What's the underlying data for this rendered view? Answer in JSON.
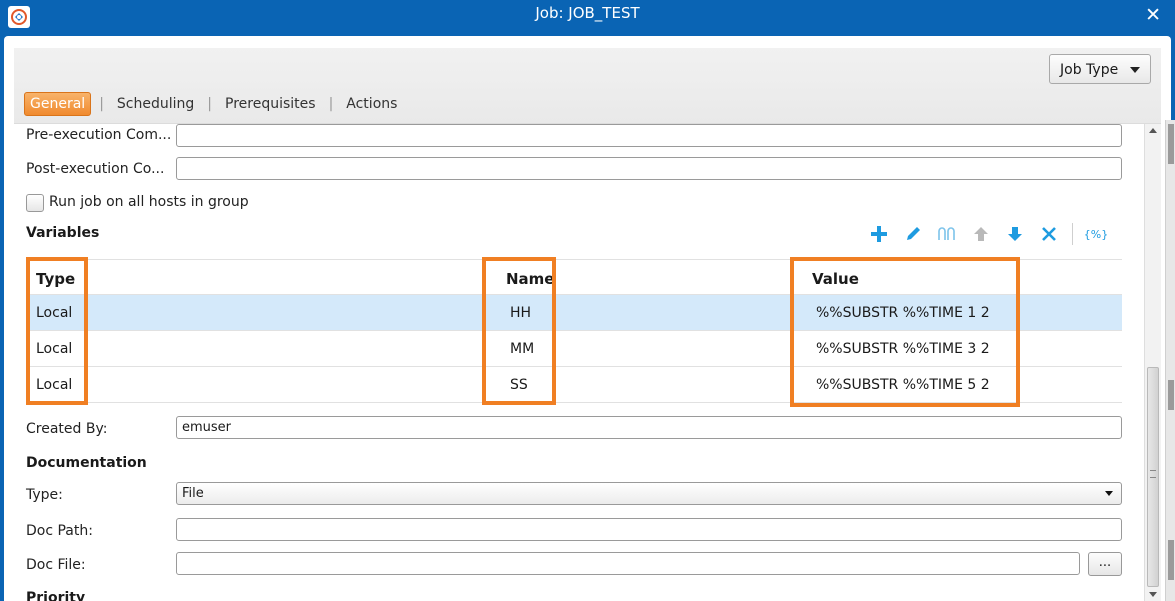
{
  "window": {
    "title": "Job: JOB_TEST",
    "close_glyph": "✕"
  },
  "header": {
    "job_type_label": "Job Type",
    "tabs": [
      {
        "label": "General",
        "active": true
      },
      {
        "label": "Scheduling",
        "active": false
      },
      {
        "label": "Prerequisites",
        "active": false
      },
      {
        "label": "Actions",
        "active": false
      }
    ]
  },
  "form": {
    "pre_exec_label": "Pre-execution Com...",
    "pre_exec_value": "",
    "post_exec_label": "Post-execution Co...",
    "post_exec_value": "",
    "run_all_hosts_label": "Run job on all hosts in group",
    "run_all_hosts_checked": false,
    "variables_title": "Variables",
    "variables_toolbar": [
      "add-icon",
      "edit-icon",
      "copy-icon",
      "move-up-icon",
      "move-down-icon",
      "delete-icon",
      "variable-icon"
    ],
    "variables_toolbar_var_glyph": "{%}",
    "variables": {
      "columns": [
        "Type",
        "Name",
        "Value"
      ],
      "rows": [
        {
          "type": "Local",
          "name": "HH",
          "value": "%%SUBSTR %%TIME 1 2"
        },
        {
          "type": "Local",
          "name": "MM",
          "value": "%%SUBSTR %%TIME 3 2"
        },
        {
          "type": "Local",
          "name": "SS",
          "value": "%%SUBSTR %%TIME 5 2"
        }
      ]
    },
    "created_by_label": "Created By:",
    "created_by_value": "emuser",
    "documentation_title": "Documentation",
    "doc_type_label": "Type:",
    "doc_type_value": "File",
    "doc_path_label": "Doc Path:",
    "doc_path_value": "",
    "doc_file_label": "Doc File:",
    "doc_file_value": "",
    "browse_label": "...",
    "priority_title": "Priority"
  },
  "colors": {
    "titlebar": "#0a64b4",
    "active_tab": "#f08a2e",
    "highlight_box": "#f07f23",
    "selected_row": "#d4e9fa",
    "toolbar_icon": "#1e9be0"
  }
}
